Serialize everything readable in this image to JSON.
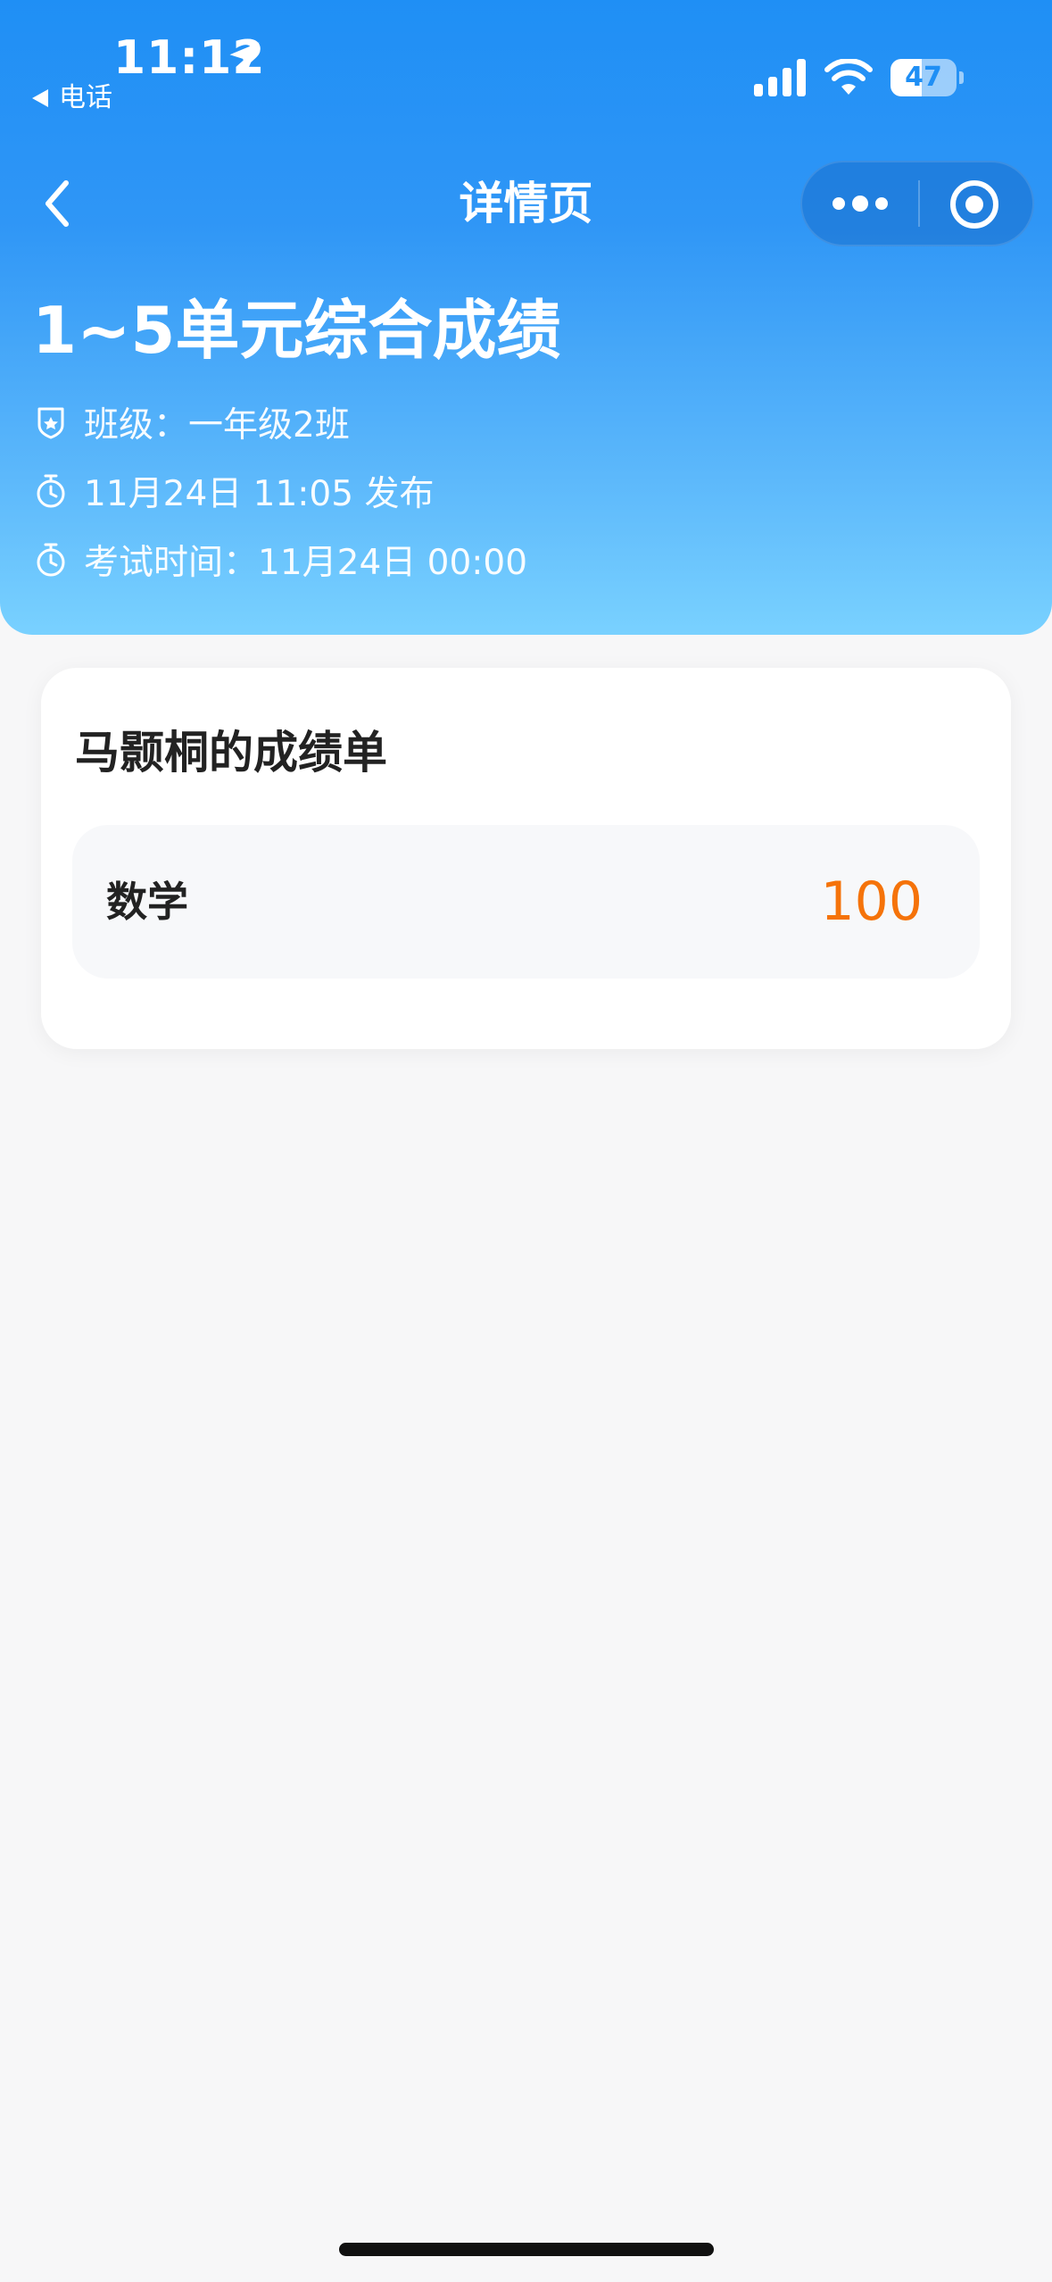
{
  "status_bar": {
    "time": "11:12",
    "back_app": "电话",
    "battery": "47",
    "battery_level": 0.47
  },
  "nav": {
    "title": "详情页"
  },
  "exam": {
    "title": "1~5单元综合成绩",
    "class_label": "班级：一年级2班",
    "published": "11月24日 11:05 发布",
    "exam_time": "考试时间：11月24日 00:00"
  },
  "report": {
    "title": "马颢桐的成绩单",
    "rows": [
      {
        "subject": "数学",
        "score": "100"
      }
    ]
  },
  "colors": {
    "header_top": "#1f8ff5",
    "header_bottom": "#79d1ff",
    "score": "#f5730a",
    "background": "#f7f7f8"
  }
}
